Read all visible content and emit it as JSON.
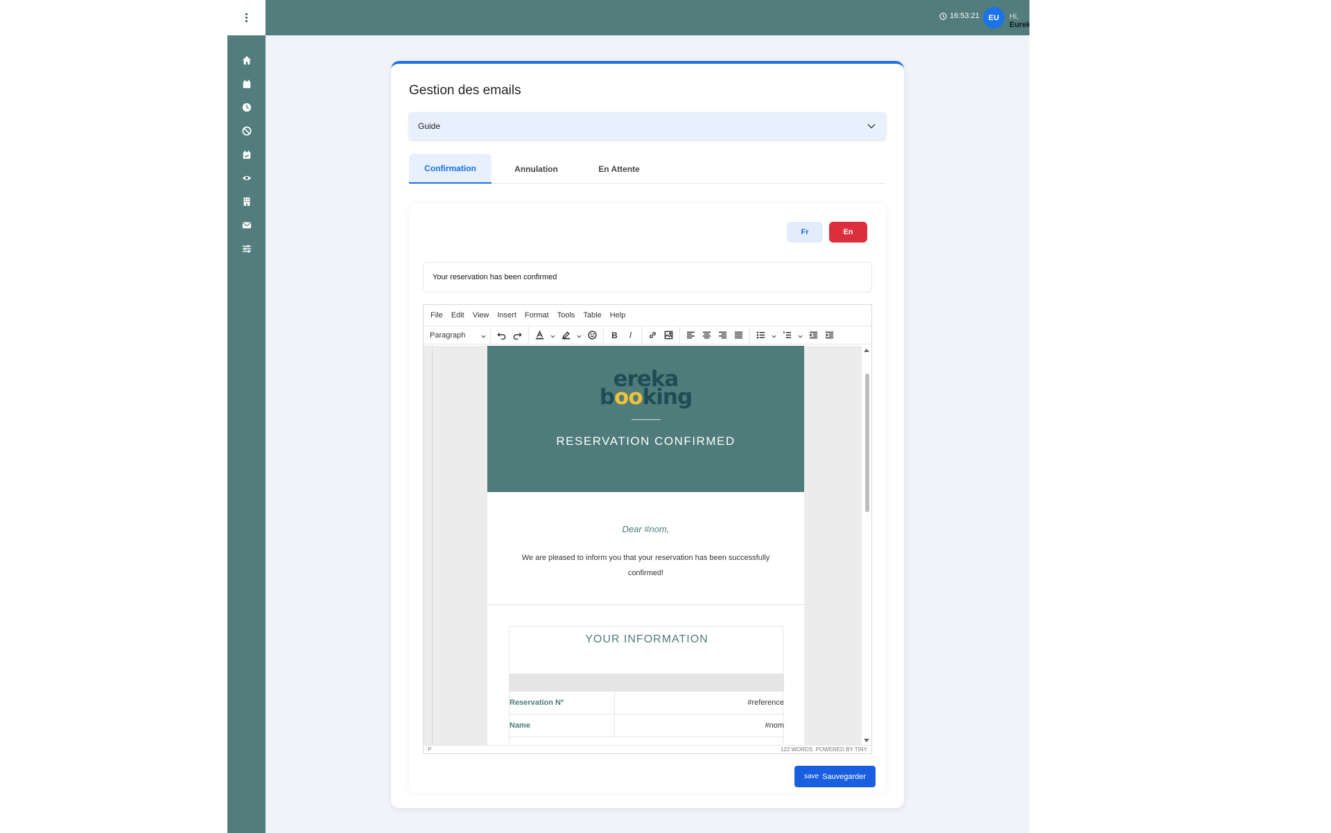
{
  "topbar": {
    "time": "16:53:21",
    "avatar_initials": "EU",
    "greeting_prefix": "Hi,",
    "user_name": "Eureka"
  },
  "sidebar": {
    "items": [
      {
        "icon": "home-icon"
      },
      {
        "icon": "calendar-icon"
      },
      {
        "icon": "clock-icon"
      },
      {
        "icon": "ban-icon"
      },
      {
        "icon": "calendar-check-icon"
      },
      {
        "icon": "eye-icon"
      },
      {
        "icon": "building-icon"
      },
      {
        "icon": "envelope-icon"
      },
      {
        "icon": "sliders-icon"
      }
    ]
  },
  "page": {
    "title": "Gestion des emails",
    "select_value": "Guide",
    "tabs": [
      {
        "label": "Confirmation",
        "active": true
      },
      {
        "label": "Annulation",
        "active": false
      },
      {
        "label": "En Attente",
        "active": false
      }
    ]
  },
  "languages": {
    "fr": "Fr",
    "en": "En"
  },
  "subject": "Your reservation has been confirmed",
  "editor": {
    "menu": [
      "File",
      "Edit",
      "View",
      "Insert",
      "Format",
      "Tools",
      "Table",
      "Help"
    ],
    "block_format": "Paragraph",
    "status_path": "P",
    "word_count": "122 WORDS",
    "powered": "POWERED BY TINY"
  },
  "email": {
    "logo_top_pre": "e",
    "logo_top_post": "reka",
    "logo_bottom_pre": "b",
    "logo_bottom_oo": "oo",
    "logo_bottom_post": "king",
    "header_title": "RESERVATION CONFIRMED",
    "greeting": "Dear #nom,",
    "message": "We are pleased to inform you that your reservation has been successfully confirmed!",
    "info_title": "YOUR INFORMATION",
    "rows": [
      {
        "key": "Reservation Nº",
        "value": "#reference"
      },
      {
        "key": "Name",
        "value": "#nom"
      }
    ]
  },
  "save": {
    "icon_text": "save",
    "label": "Sauvegarder"
  },
  "colors": {
    "sidebar": "#537c7c",
    "primary": "#1a6ee8",
    "danger": "#dc2f3e",
    "email_header": "#4f7b7b"
  }
}
